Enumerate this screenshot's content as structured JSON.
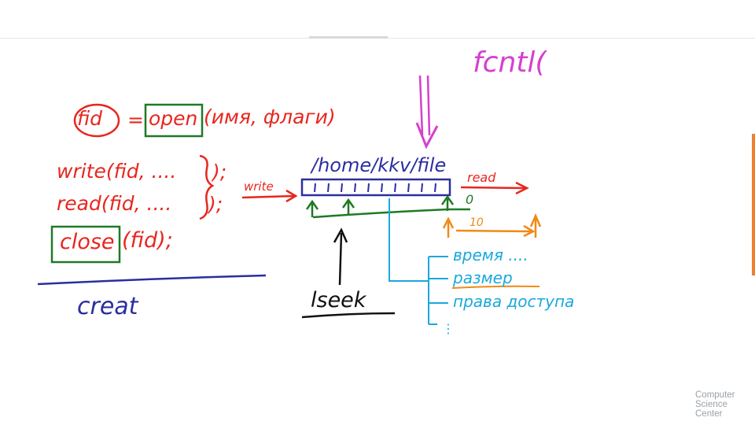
{
  "board": {
    "fcntl": "fcntl(",
    "fid_line": {
      "fid": "fid",
      "eq": "=",
      "open": "open",
      "args": "(имя, флаги)"
    },
    "write_call": "write(fid, ....",
    "write_end": ");",
    "read_call": "read(fid, ....",
    "read_end": ");",
    "close_line": {
      "close": "close",
      "rest": "(fid);"
    },
    "creat": "creat",
    "path": "/home/kkv/file",
    "write_arrow_label": "write",
    "read_arrow_label": "read",
    "zero": "0",
    "ten": "10",
    "lseek": "lseek",
    "attributes": [
      "время ....",
      "размер",
      "права доступа"
    ],
    "more_mark": "⋮"
  },
  "logo": {
    "lines": [
      "Computer",
      "Science",
      "Center"
    ]
  }
}
